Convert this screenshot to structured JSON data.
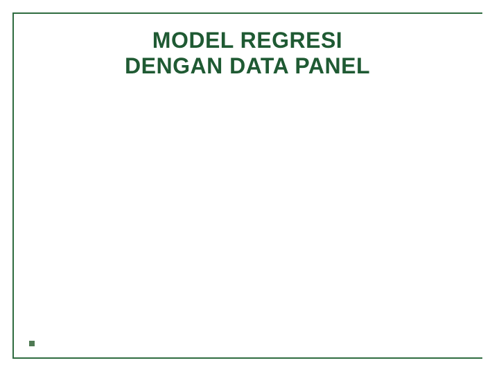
{
  "slide": {
    "title_line1": "MODEL REGRESI",
    "title_line2": "DENGAN DATA PANEL"
  },
  "colors": {
    "frame": "#2e6b3f",
    "title": "#1f5a33",
    "bullet": "#4f7a54"
  }
}
